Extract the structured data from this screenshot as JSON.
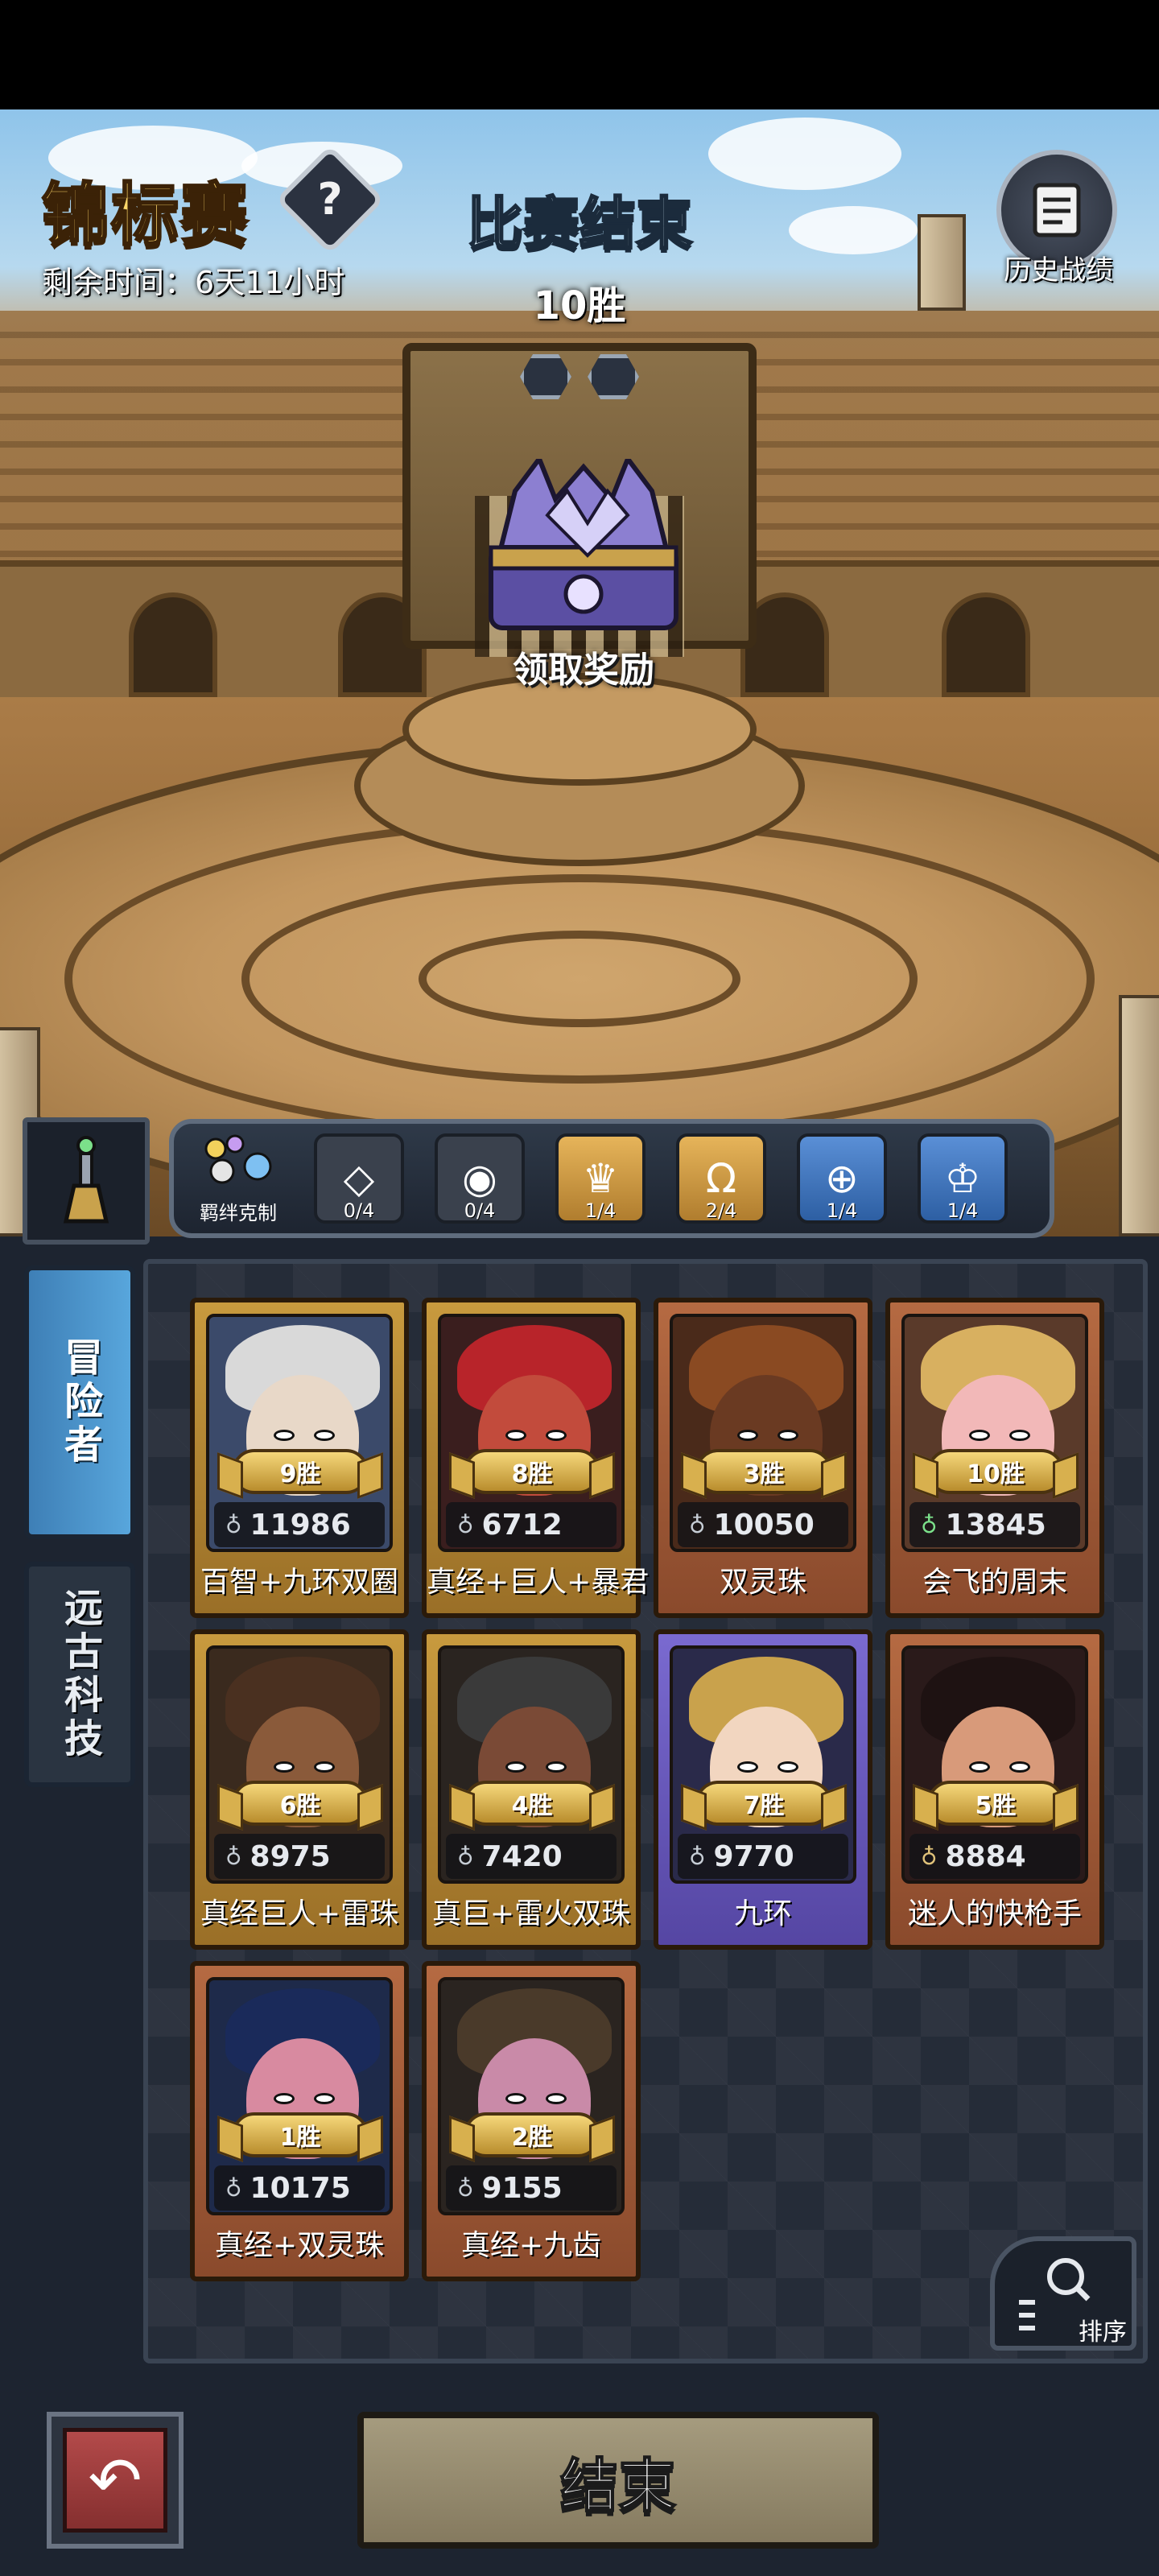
{
  "header": {
    "title": "锦标赛",
    "help_icon": "?",
    "remaining_time": "剩余时间：6天11小时",
    "match_title": "比赛结束",
    "wins": "10胜",
    "history_label": "历史战绩",
    "claim_label": "领取奖励"
  },
  "synergy": {
    "label": "羁绊克制",
    "items": [
      {
        "count": "0/4",
        "icon": "crystal-icon",
        "style": "gray"
      },
      {
        "count": "0/4",
        "icon": "eye-icon",
        "style": "gray"
      },
      {
        "count": "1/4",
        "icon": "crown-icon",
        "style": "gold"
      },
      {
        "count": "2/4",
        "icon": "horseshoe-icon",
        "style": "gold"
      },
      {
        "count": "1/4",
        "icon": "orb-icon",
        "style": "blue"
      },
      {
        "count": "1/4",
        "icon": "figure-icon",
        "style": "blue"
      }
    ]
  },
  "tabs": {
    "adventurer": "冒险者",
    "ancient_tech": "远古科技"
  },
  "cards": [
    {
      "wins": "9胜",
      "power": "11986",
      "name": "百智+九环双圈",
      "frame": "gold"
    },
    {
      "wins": "8胜",
      "power": "6712",
      "name": "真经+巨人+暴君",
      "frame": "gold"
    },
    {
      "wins": "3胜",
      "power": "10050",
      "name": "双灵珠",
      "frame": "red"
    },
    {
      "wins": "10胜",
      "power": "13845",
      "name": "会飞的周末",
      "frame": "red"
    },
    {
      "wins": "6胜",
      "power": "8975",
      "name": "真经巨人+雷珠",
      "frame": "gold"
    },
    {
      "wins": "4胜",
      "power": "7420",
      "name": "真巨+雷火双珠",
      "frame": "gold"
    },
    {
      "wins": "7胜",
      "power": "9770",
      "name": "九环",
      "frame": "purple"
    },
    {
      "wins": "5胜",
      "power": "8884",
      "name": "迷人的快枪手",
      "frame": "red"
    },
    {
      "wins": "1胜",
      "power": "10175",
      "name": "真经+双灵珠",
      "frame": "red"
    },
    {
      "wins": "2胜",
      "power": "9155",
      "name": "真经+九齿",
      "frame": "red"
    }
  ],
  "sort_label": "排序",
  "end_button": "结束"
}
